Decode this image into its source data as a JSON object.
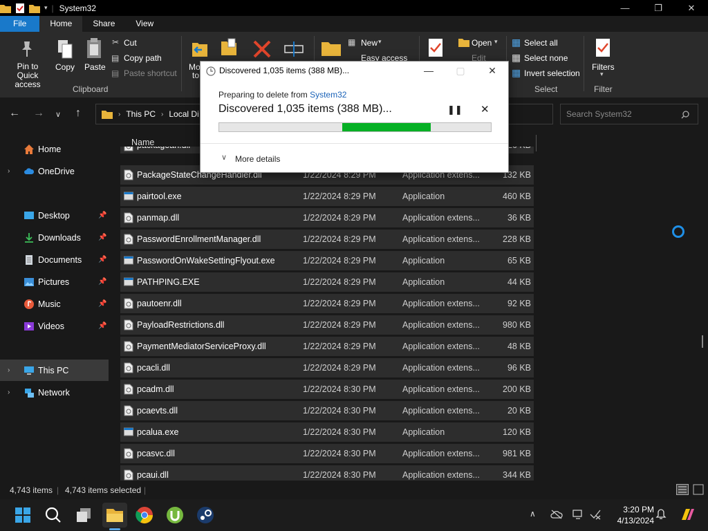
{
  "window": {
    "title": "System32",
    "controls": {
      "minimize": "—",
      "maximize": "❐",
      "close": "✕"
    }
  },
  "tabs": [
    "File",
    "Home",
    "Share",
    "View"
  ],
  "ribbon": {
    "clipboard": {
      "pin": "Pin to Quick access",
      "copy": "Copy",
      "paste": "Paste",
      "cut": "Cut",
      "copy_path": "Copy path",
      "paste_shortcut": "Paste shortcut",
      "group_label": "Clipboard"
    },
    "organize": {
      "move_to": "Mo",
      "move_to_2": "to"
    },
    "new": {
      "new_item": "New",
      "easy_access": "Easy access"
    },
    "open": {
      "open": "Open",
      "edit": "Edit"
    },
    "select": {
      "select_all": "Select all",
      "select_none": "Select none",
      "invert_selection": "Invert selection",
      "group_label": "Select"
    },
    "filter": {
      "filters": "Filters",
      "group_label": "Filter"
    }
  },
  "address": {
    "segments": [
      "This PC",
      "Local Di"
    ],
    "search_placeholder": "Search System32"
  },
  "sidebar": {
    "items": [
      {
        "label": "Home",
        "icon": "home-icon"
      },
      {
        "label": "OneDrive",
        "icon": "cloud-icon"
      },
      {
        "label": "Desktop",
        "icon": "desktop-icon"
      },
      {
        "label": "Downloads",
        "icon": "download-icon"
      },
      {
        "label": "Documents",
        "icon": "document-icon"
      },
      {
        "label": "Pictures",
        "icon": "picture-icon"
      },
      {
        "label": "Music",
        "icon": "music-icon"
      },
      {
        "label": "Videos",
        "icon": "video-icon"
      },
      {
        "label": "This PC",
        "icon": "computer-icon"
      },
      {
        "label": "Network",
        "icon": "network-icon"
      }
    ]
  },
  "filelist": {
    "column_name": "Name",
    "rows": [
      {
        "name": "packageah.dll",
        "date": "",
        "type": "",
        "size": "26 KB",
        "kind": "dll"
      },
      {
        "name": "PackageStateChangeHandler.dll",
        "date": "1/22/2024 8:29 PM",
        "type": "Application extens...",
        "size": "132 KB",
        "kind": "dll"
      },
      {
        "name": "pairtool.exe",
        "date": "1/22/2024 8:29 PM",
        "type": "Application",
        "size": "460 KB",
        "kind": "exe"
      },
      {
        "name": "panmap.dll",
        "date": "1/22/2024 8:29 PM",
        "type": "Application extens...",
        "size": "36 KB",
        "kind": "dll"
      },
      {
        "name": "PasswordEnrollmentManager.dll",
        "date": "1/22/2024 8:29 PM",
        "type": "Application extens...",
        "size": "228 KB",
        "kind": "dll"
      },
      {
        "name": "PasswordOnWakeSettingFlyout.exe",
        "date": "1/22/2024 8:29 PM",
        "type": "Application",
        "size": "65 KB",
        "kind": "exe"
      },
      {
        "name": "PATHPING.EXE",
        "date": "1/22/2024 8:29 PM",
        "type": "Application",
        "size": "44 KB",
        "kind": "exe"
      },
      {
        "name": "pautoenr.dll",
        "date": "1/22/2024 8:29 PM",
        "type": "Application extens...",
        "size": "92 KB",
        "kind": "dll"
      },
      {
        "name": "PayloadRestrictions.dll",
        "date": "1/22/2024 8:29 PM",
        "type": "Application extens...",
        "size": "980 KB",
        "kind": "dll"
      },
      {
        "name": "PaymentMediatorServiceProxy.dll",
        "date": "1/22/2024 8:29 PM",
        "type": "Application extens...",
        "size": "48 KB",
        "kind": "dll"
      },
      {
        "name": "pcacli.dll",
        "date": "1/22/2024 8:29 PM",
        "type": "Application extens...",
        "size": "96 KB",
        "kind": "dll"
      },
      {
        "name": "pcadm.dll",
        "date": "1/22/2024 8:30 PM",
        "type": "Application extens...",
        "size": "200 KB",
        "kind": "dll"
      },
      {
        "name": "pcaevts.dll",
        "date": "1/22/2024 8:30 PM",
        "type": "Application extens...",
        "size": "20 KB",
        "kind": "dll"
      },
      {
        "name": "pcalua.exe",
        "date": "1/22/2024 8:30 PM",
        "type": "Application",
        "size": "120 KB",
        "kind": "exe"
      },
      {
        "name": "pcasvc.dll",
        "date": "1/22/2024 8:30 PM",
        "type": "Application extens...",
        "size": "981 KB",
        "kind": "dll"
      },
      {
        "name": "pcaui.dll",
        "date": "1/22/2024 8:30 PM",
        "type": "Application extens...",
        "size": "344 KB",
        "kind": "dll"
      }
    ]
  },
  "status": {
    "item_count": "4,743 items",
    "selected_count": "4,743 items selected"
  },
  "dialog": {
    "title": "Discovered 1,035 items (388 MB)...",
    "preparing_prefix": "Preparing to delete from ",
    "preparing_location": "System32",
    "discovered": "Discovered 1,035 items (388 MB)...",
    "more_details": "More details"
  },
  "taskbar": {
    "time": "3:20 PM",
    "date": "4/13/2024",
    "apps": [
      "start-icon",
      "search-icon",
      "task-view-icon",
      "file-explorer-icon",
      "chrome-icon",
      "utorrent-icon",
      "steam-icon"
    ]
  },
  "colors": {
    "accent": "#1979ca",
    "progress": "#06b025",
    "link": "#1a62b8",
    "busy": "#1f8fe6"
  }
}
